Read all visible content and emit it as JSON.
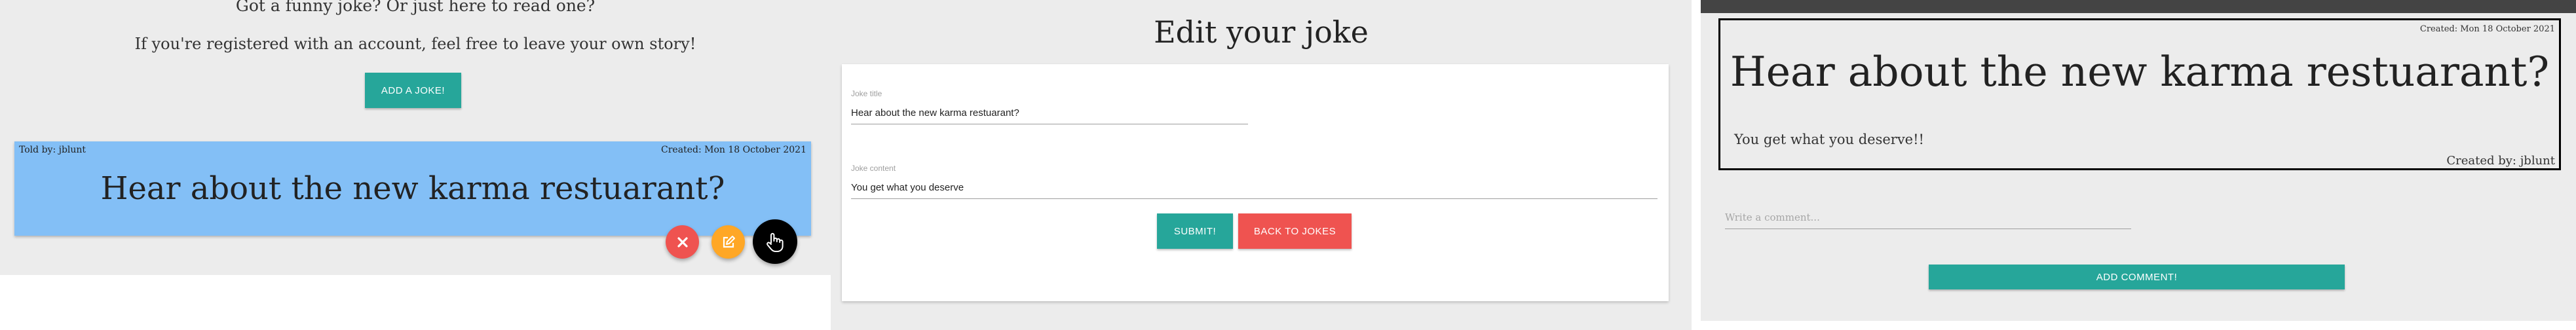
{
  "jokes_page": {
    "intro_line_1": "Got a funny joke? Or just here to read one?",
    "intro_line_2": "If you're registered with an account, feel free to leave your own story!",
    "add_joke_label": "ADD A JOKE!",
    "card": {
      "told_by": "Told by: jblunt",
      "created": "Created: Mon 18 October 2021",
      "title": "Hear about the new karma restuarant?"
    },
    "actions": {
      "delete_icon": "close-icon",
      "edit_icon": "edit-icon",
      "open_icon": "pointer-hand-icon"
    }
  },
  "edit_page": {
    "heading": "Edit your joke",
    "title_label": "Joke title",
    "title_value": "Hear about the new karma restuarant?",
    "content_label": "Joke content",
    "content_value": "You get what you deserve",
    "submit_label": "SUBMIT!",
    "back_label": "BACK TO JOKES"
  },
  "detail_page": {
    "created": "Created: Mon 18 October 2021",
    "title": "Hear about the new karma restuarant?",
    "content": "You get what you deserve!!",
    "created_by": "Created by: jblunt",
    "comment_placeholder": "Write a comment...",
    "add_comment_label": "ADD COMMENT!"
  },
  "colors": {
    "teal": "#26a69a",
    "red": "#ef5350",
    "orange": "#ffa726",
    "card_blue": "#83bff6",
    "page_bg": "#ececec"
  }
}
